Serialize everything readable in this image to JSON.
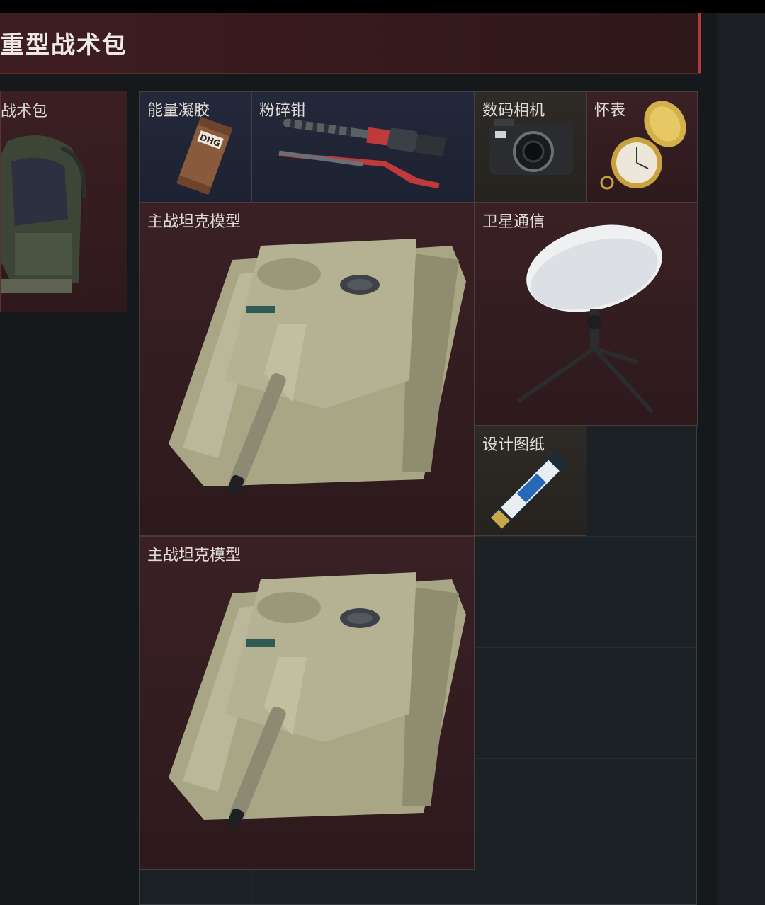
{
  "header": {
    "title": "重型战术包"
  },
  "backpack": {
    "label": "战术包",
    "icon": "backpack-icon"
  },
  "grid": {
    "items": [
      {
        "name": "能量凝胶",
        "icon": "energy-gel-icon",
        "rarity_color": "#23283a"
      },
      {
        "name": "粉碎钳",
        "icon": "crusher-pliers-icon",
        "rarity_color": "#23283a"
      },
      {
        "name": "数码相机",
        "icon": "digital-camera-icon",
        "rarity_color": "#2e2a26"
      },
      {
        "name": "怀表",
        "icon": "pocket-watch-icon",
        "rarity_color": "#3a2024"
      },
      {
        "name": "主战坦克模型",
        "icon": "tank-model-icon",
        "rarity_color": "#3a2024"
      },
      {
        "name": "卫星通信",
        "icon": "satellite-dish-icon",
        "rarity_color": "#3a2024"
      },
      {
        "name": "设计图纸",
        "icon": "ssd-drive-icon",
        "rarity_color": "#2e2a26"
      },
      {
        "name": "主战坦克模型",
        "icon": "tank-model-icon",
        "rarity_color": "#3a2024"
      }
    ]
  }
}
